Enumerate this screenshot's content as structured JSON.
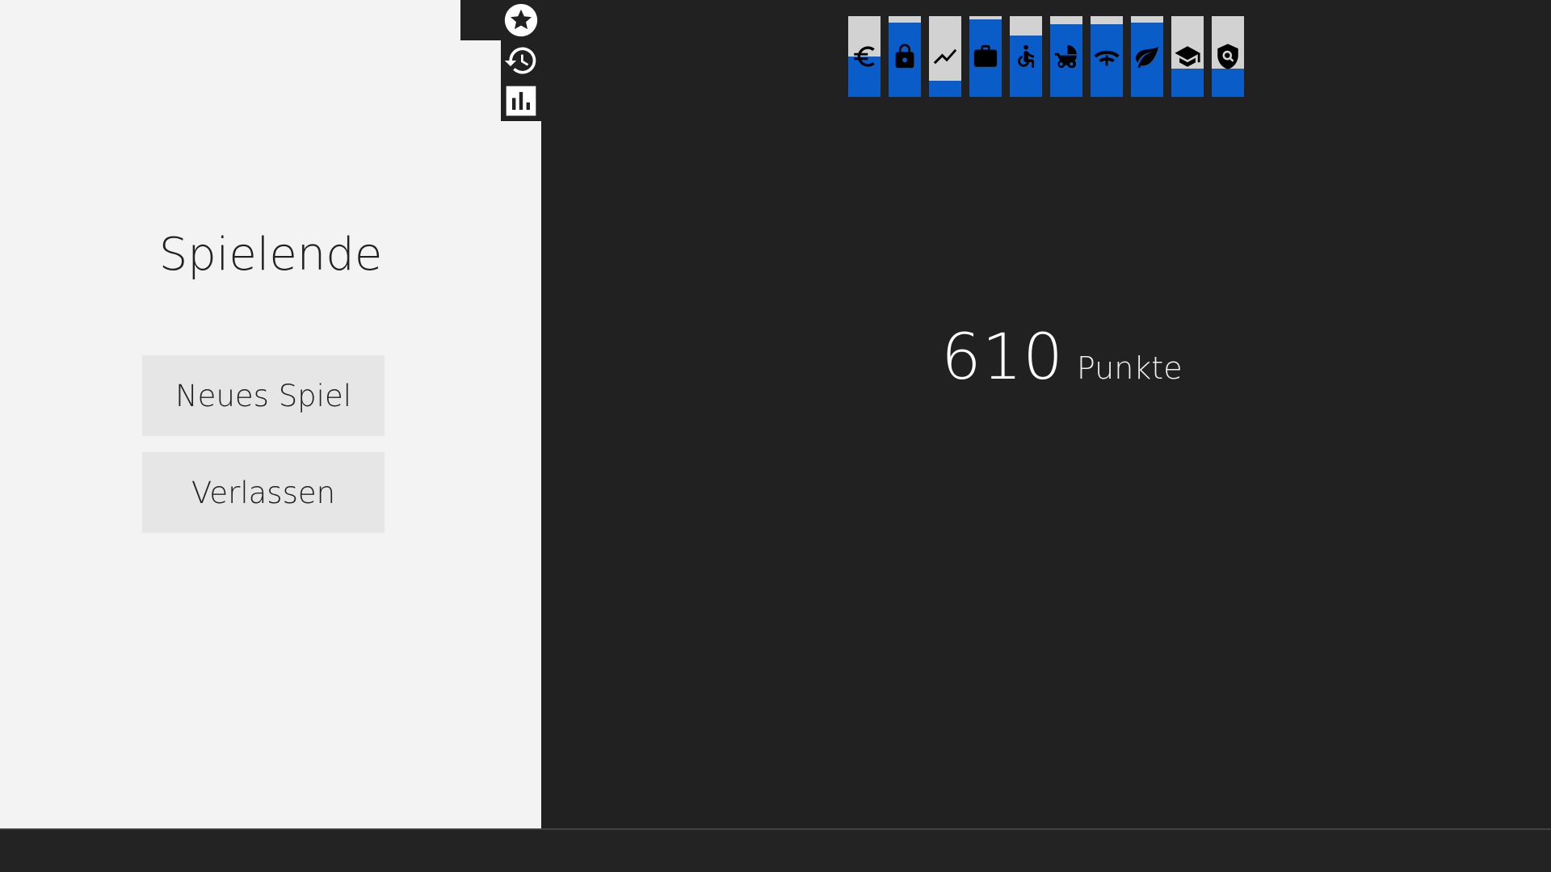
{
  "colors": {
    "panel_background": "#f3f3f3",
    "game_background": "#212121",
    "bar_fill": "#0a5dc8",
    "bar_track": "#d2d2d2",
    "button_background": "#e6e6e6"
  },
  "end_screen": {
    "title": "Spielende",
    "buttons": {
      "new_game": "Neues Spiel",
      "leave": "Verlassen"
    }
  },
  "side_icons": [
    "star-icon",
    "history-icon",
    "bar-chart-icon"
  ],
  "indicators": [
    {
      "icon": "euro-icon",
      "level": 0.5
    },
    {
      "icon": "lock-icon",
      "level": 0.92
    },
    {
      "icon": "trending-icon",
      "level": 0.2
    },
    {
      "icon": "briefcase-icon",
      "level": 0.96
    },
    {
      "icon": "accessibility-icon",
      "level": 0.76
    },
    {
      "icon": "baby-carriage-icon",
      "level": 0.9
    },
    {
      "icon": "broadband-icon",
      "level": 0.9
    },
    {
      "icon": "leaf-icon",
      "level": 0.92
    },
    {
      "icon": "school-icon",
      "level": 0.35
    },
    {
      "icon": "security-icon",
      "level": 0.35
    }
  ],
  "score": {
    "value": "610",
    "unit": "Punkte"
  }
}
